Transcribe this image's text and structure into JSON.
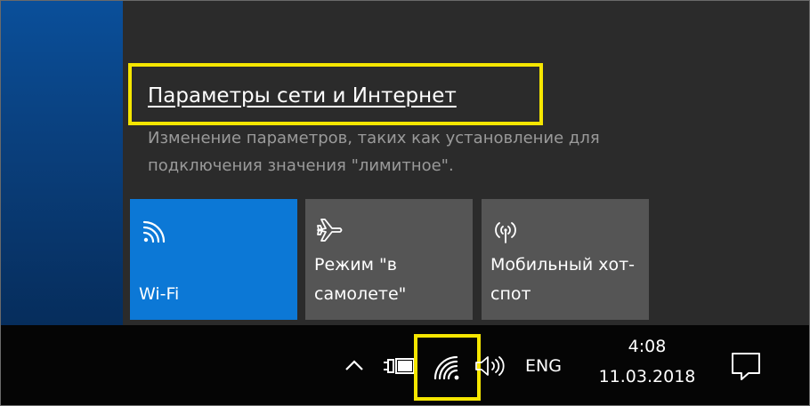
{
  "flyout": {
    "settings_link": "Параметры сети и Интернет",
    "description": "Изменение параметров, таких как установление для подключения значения \"лимитное\".",
    "tiles": [
      {
        "label": "Wi-Fi",
        "icon": "wifi-icon",
        "active": true
      },
      {
        "label": "Режим \"в самолете\"",
        "icon": "airplane-icon",
        "active": false
      },
      {
        "label": "Мобильный хот-спот",
        "icon": "hotspot-icon",
        "active": false
      }
    ]
  },
  "taskbar": {
    "language": "ENG",
    "time": "4:08",
    "date": "11.03.2018",
    "icons": [
      "chevron-up-icon",
      "power-icon",
      "wifi-icon",
      "volume-icon",
      "notification-icon"
    ]
  },
  "colors": {
    "accent": "#0c78d6",
    "highlight": "#f5e600",
    "flyout_bg": "#2b2b2b",
    "tile_bg": "#555555"
  }
}
